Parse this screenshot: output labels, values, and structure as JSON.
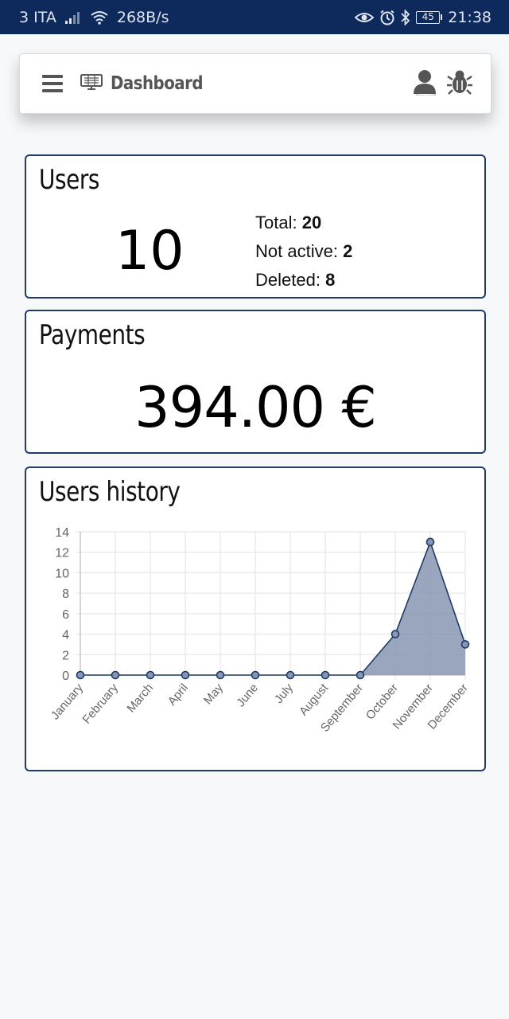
{
  "status_bar": {
    "carrier": "3 ITA",
    "speed": "268B/s",
    "battery": "45",
    "time": "21:38"
  },
  "header": {
    "title": "Dashboard"
  },
  "users_card": {
    "title": "Users",
    "count": "10",
    "total_label": "Total:",
    "total_value": "20",
    "not_active_label": "Not active:",
    "not_active_value": "2",
    "deleted_label": "Deleted:",
    "deleted_value": "8"
  },
  "payments_card": {
    "title": "Payments",
    "amount": "394.00 €"
  },
  "history_card": {
    "title": "Users history"
  },
  "colors": {
    "status_bar": "#0e2a5c",
    "card_border": "#1f3b66",
    "chart_fill": "#8796b3",
    "chart_line": "#1f3b66"
  },
  "chart_data": {
    "type": "area",
    "title": "Users history",
    "categories": [
      "January",
      "February",
      "March",
      "April",
      "May",
      "June",
      "July",
      "August",
      "September",
      "October",
      "November",
      "December"
    ],
    "values": [
      0,
      0,
      0,
      0,
      0,
      0,
      0,
      0,
      0,
      4,
      13,
      3
    ],
    "yticks": [
      "0",
      "2",
      "4",
      "6",
      "8",
      "10",
      "12",
      "14"
    ],
    "ylim": [
      0,
      14
    ],
    "grid": true,
    "legend": "none"
  }
}
